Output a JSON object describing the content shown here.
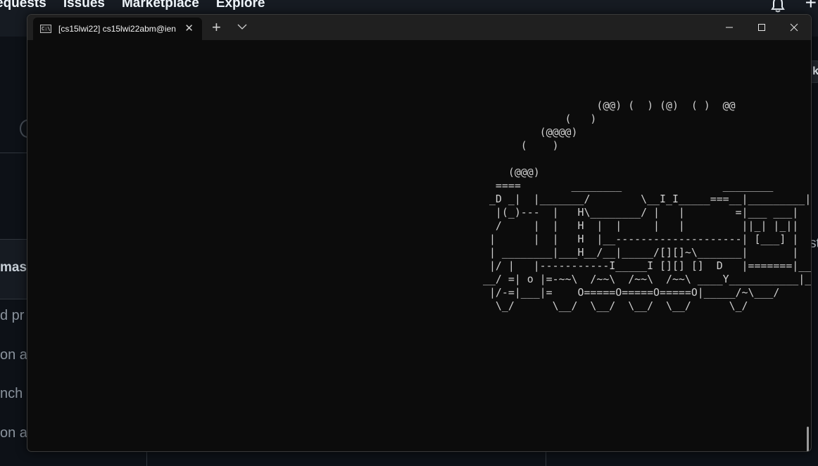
{
  "github": {
    "nav": [
      "equests",
      "Issues",
      "Marketplace",
      "Explore"
    ],
    "master_label": "mast",
    "side_snippets": [
      "d pr",
      "on a",
      "nch",
      "on a"
    ],
    "right_button": "k",
    "right_text": "st"
  },
  "terminal": {
    "tab_icon": "C:\\",
    "tab_title": "[cs15lwi22]  cs15lwi22abm@ien",
    "tab_close": "✕",
    "new_tab": "+",
    "train_lines": [
      "                  (@@) (  ) (@)  ( )  @@",
      "             (   )",
      "         (@@@@)",
      "      (    )",
      "",
      "    (@@@)",
      "  ====        ________                ________",
      " _D _|  |_______/        \\__I_I_____===__|_________|",
      "  |(_)---  |   H\\________/ |   |        =|___ ___|",
      "  /     |  |   H  |  |     |   |         ||_| |_||",
      " |      |  |   H  |__--------------------| [___] |",
      " | ________|___H__/__|_____/[][]~\\_______|       |",
      " |/ |   |-----------I_____I [][] []  D   |=======|__",
      "__/ =| o |=-~~\\  /~~\\  /~~\\  /~~\\ ____Y___________|__",
      " |/-=|___|=    O=====O=====O=====O|_____/~\\___/",
      "  \\_/      \\__/  \\__/  \\__/  \\__/      \\_/"
    ]
  }
}
